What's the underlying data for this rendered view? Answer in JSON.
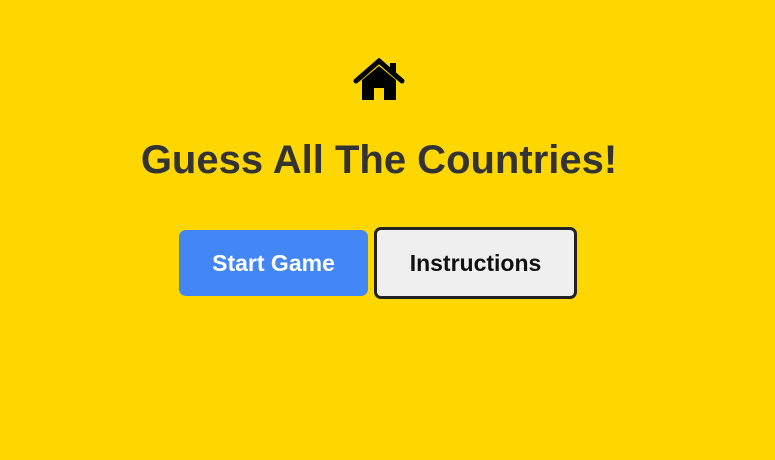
{
  "header": {
    "icon": "home-icon"
  },
  "main": {
    "title": "Guess All The Countries!",
    "buttons": {
      "start_label": "Start Game",
      "instructions_label": "Instructions"
    }
  },
  "colors": {
    "background": "#FFD700",
    "title_text": "#333333",
    "start_button_bg": "#4287F5",
    "start_button_text": "#FFFFFF",
    "instructions_button_bg": "#EFEFEF",
    "instructions_button_border": "#222222"
  }
}
